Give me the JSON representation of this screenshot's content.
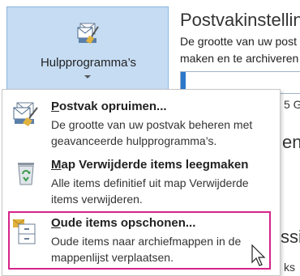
{
  "background": {
    "title": "Postvakinstelling",
    "line1": "De grootte van uw post",
    "line2": "maken en te archiveren",
    "frag1": "5 G",
    "frag2": "en",
    "frag3": "ssi",
    "frag4": "ks"
  },
  "tools": {
    "label": "Hulpprogramma’s",
    "icon": "tools-envelope-broom-icon"
  },
  "menu": {
    "items": [
      {
        "title_first": "P",
        "title_rest": "ostvak opruimen...",
        "desc": "De grootte van uw postvak beheren met geavanceerde hulpprogramma’s.",
        "icon": "mailbox-cleanup-icon"
      },
      {
        "title_first": "M",
        "title_rest": "ap Verwijderde items leegmaken",
        "desc": "Alle items definitief uit map Verwijderde items verwijderen.",
        "icon": "recycle-bin-icon"
      },
      {
        "title_first": "O",
        "title_rest": "ude items opschonen...",
        "desc": "Oude items naar archiefmappen in de mappenlijst verplaatsen.",
        "icon": "archive-cabinet-icon"
      }
    ]
  },
  "colors": {
    "highlight": "#d6248a",
    "button_pressed": "#c5dcf3",
    "accent_blue": "#2b78c9"
  }
}
